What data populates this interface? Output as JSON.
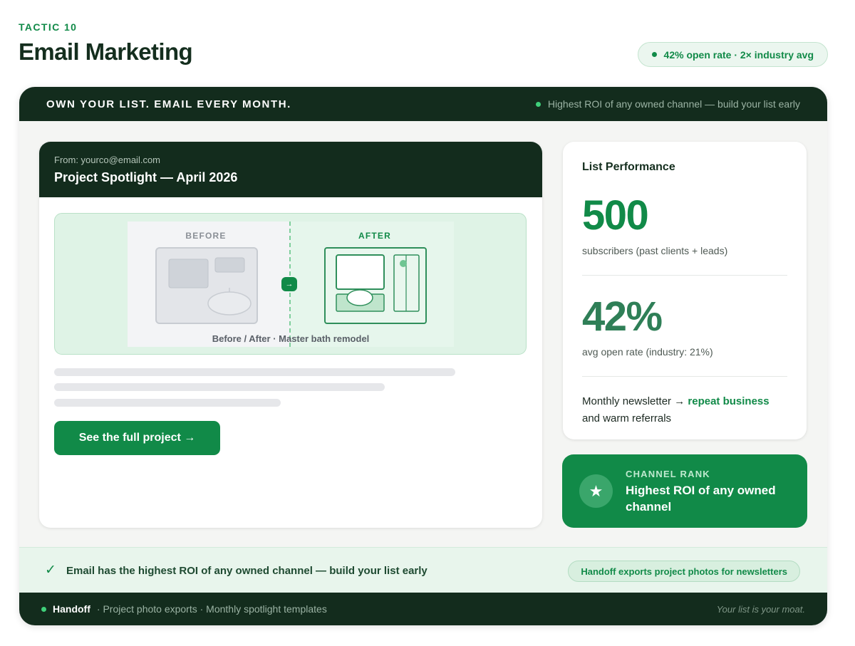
{
  "header": {
    "eyebrow": "TACTIC 10",
    "title": "Email Marketing",
    "stat_pill": "42% open rate · 2× industry avg"
  },
  "banner": {
    "title": "OWN YOUR LIST. EMAIL EVERY MONTH.",
    "note": "Highest ROI of any owned channel — build your list early"
  },
  "email_preview": {
    "from": "From: yourco@email.com",
    "subject": "Project Spotlight — April 2026",
    "before_label": "BEFORE",
    "after_label": "AFTER",
    "handle_glyph": "→",
    "caption": "Before / After · Master bath remodel",
    "cta_label": "See the full project →"
  },
  "list_performance": {
    "title": "List Performance",
    "subscribers_value": "500",
    "subscribers_caption": "subscribers (past clients + leads)",
    "open_rate_value": "42%",
    "open_rate_caption": "avg open rate (industry: 21%)",
    "note_prefix": "Monthly newsletter → ",
    "note_highlight": "repeat business",
    "note_suffix": "and warm referrals"
  },
  "channel_rank": {
    "icon": "star-icon",
    "kicker": "CHANNEL RANK",
    "text": "Highest ROI of any owned channel"
  },
  "footer_strip": {
    "message": "Email has the highest ROI of any owned channel — build your list early",
    "pill": "Handoff exports project photos for newsletters"
  },
  "bottom_bar": {
    "brand": "Handoff",
    "details": "· Project photo exports · Monthly spotlight templates",
    "tagline": "Your list is your moat."
  },
  "colors": {
    "brand_green": "#118a48",
    "dark_green": "#132c1d",
    "accent_dot": "#3fd07a"
  }
}
